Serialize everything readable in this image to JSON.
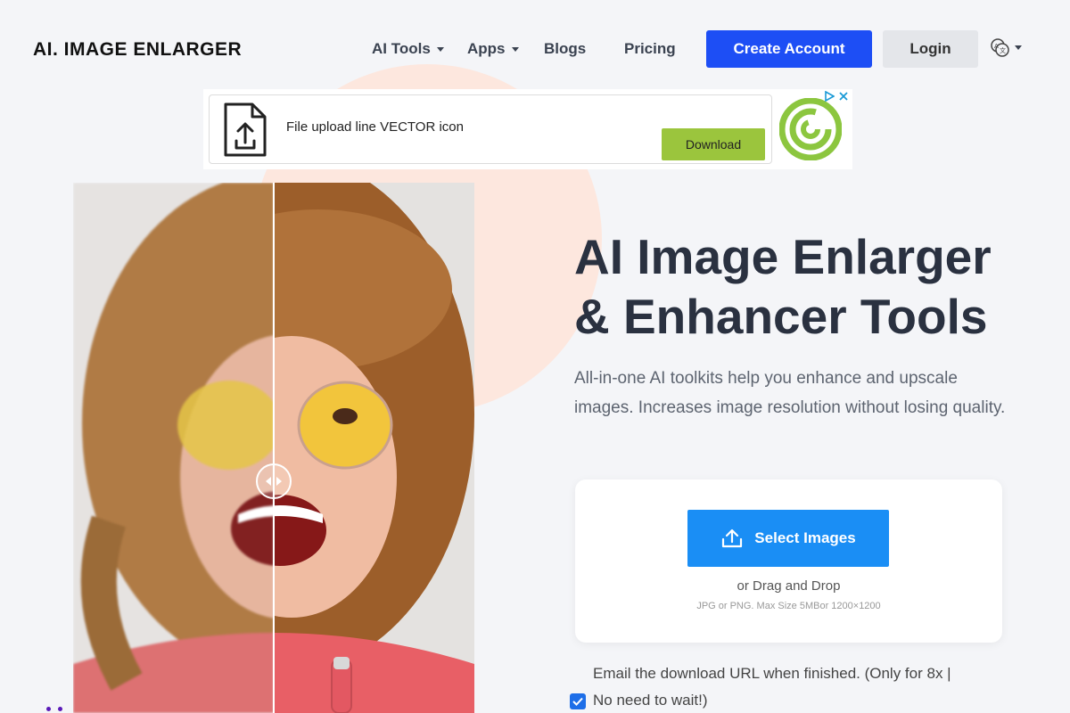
{
  "header": {
    "logo": "AI. IMAGE ENLARGER",
    "nav": [
      {
        "label": "AI Tools",
        "dropdown": true
      },
      {
        "label": "Apps",
        "dropdown": true
      },
      {
        "label": "Blogs",
        "dropdown": false
      },
      {
        "label": "Pricing",
        "dropdown": false
      }
    ],
    "create_account": "Create Account",
    "login": "Login",
    "language_icon": "translate-icon"
  },
  "ad": {
    "text": "File upload line VECTOR icon",
    "download": "Download",
    "icon": "file-upload-icon",
    "logo_icon": "spiral-logo-icon",
    "ad_choices": [
      "adchoices-icon",
      "close-icon"
    ]
  },
  "photo": {
    "description_icon": "before-after-slider",
    "slider_position": 0.5
  },
  "hero": {
    "title_line1": "AI Image Enlarger",
    "title_line2": "& Enhancer Tools",
    "subtitle": "All-in-one AI toolkits help you enhance and upscale images. Increases image resolution without losing quality."
  },
  "upload": {
    "select_label": "Select Images",
    "drag_text": "or Drag and Drop",
    "hint": "JPG or PNG. Max Size 5MBor 1200×1200"
  },
  "email_option": {
    "line1": "Email the download URL when finished. (Only for 8x |",
    "line2": "No need to wait!)",
    "checked": true
  },
  "colors": {
    "primary": "#1d4ef5",
    "select": "#1a8ef5",
    "ad_green": "#9bc53d",
    "deco": "#fde7de"
  }
}
